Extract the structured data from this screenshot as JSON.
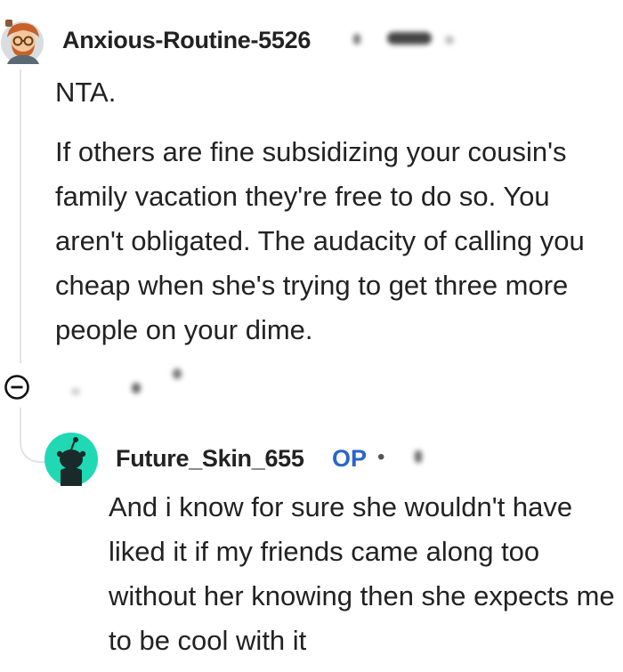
{
  "comment": {
    "username": "Anxious-Routine-5526",
    "verdict": "NTA.",
    "body": "If others are fine subsidizing your cousin's family vacation they're free to do so. You aren't obligated. The audacity of calling you cheap when she's trying to get three more people on your dime.",
    "avatar_icon": "cartoon-avatar-icon",
    "collapse_icon": "minus-circle-icon"
  },
  "reply": {
    "username": "Future_Skin_655",
    "op_label": "OP",
    "separator": "•",
    "body": "And i know for sure she wouldn't have liked it if my friends came along too without her knowing then she expects me to be cool with it",
    "avatar_icon": "snoo-avatar-icon"
  },
  "colors": {
    "op_blue": "#2a66c9",
    "reply_avatar_bg": "#20d9b4",
    "thread_line": "#e3e3e3"
  }
}
